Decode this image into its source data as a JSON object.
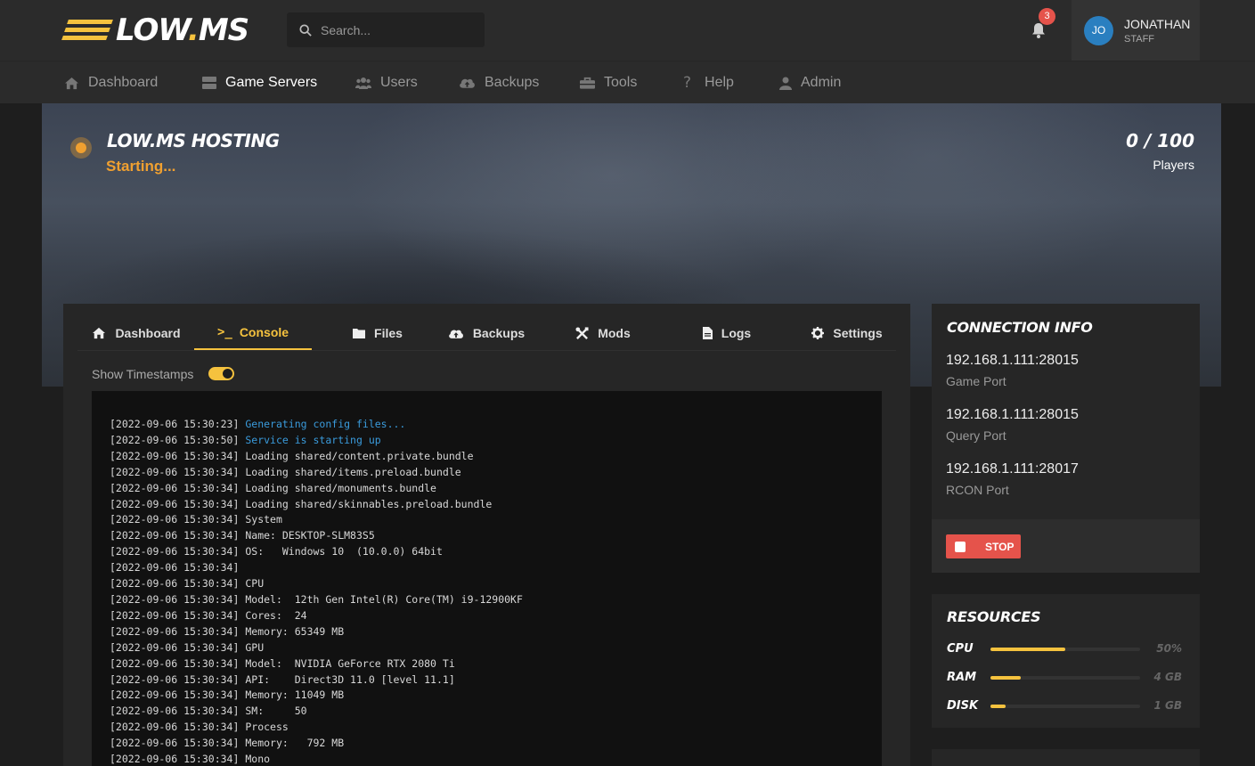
{
  "header": {
    "logo_text": "LOW",
    "logo_dot": ".",
    "logo_suffix": "MS",
    "search_placeholder": "Search...",
    "notification_count": "3",
    "user": {
      "initials": "JO",
      "name": "JONATHAN",
      "role": "STAFF"
    }
  },
  "nav": [
    {
      "label": "Dashboard",
      "icon": "home-icon"
    },
    {
      "label": "Game Servers",
      "icon": "server-icon",
      "active": true
    },
    {
      "label": "Users",
      "icon": "users-icon"
    },
    {
      "label": "Backups",
      "icon": "cloud-upload-icon"
    },
    {
      "label": "Tools",
      "icon": "toolbox-icon"
    },
    {
      "label": "Help",
      "icon": "question-icon"
    },
    {
      "label": "Admin",
      "icon": "user-icon"
    }
  ],
  "server": {
    "name": "LOW.MS HOSTING",
    "status": "Starting...",
    "status_color": "#f0a030",
    "players": "0 / 100",
    "players_label": "Players"
  },
  "tabs": [
    {
      "label": "Dashboard",
      "icon": "home-icon"
    },
    {
      "label": "Console",
      "icon": "terminal-icon",
      "active": true
    },
    {
      "label": "Files",
      "icon": "folder-icon"
    },
    {
      "label": "Backups",
      "icon": "cloud-upload-icon"
    },
    {
      "label": "Mods",
      "icon": "tools-icon"
    },
    {
      "label": "Logs",
      "icon": "file-icon"
    },
    {
      "label": "Settings",
      "icon": "gear-icon"
    }
  ],
  "console": {
    "show_timestamps_label": "Show Timestamps",
    "show_timestamps": true,
    "lines": [
      {
        "ts": "[2022-09-06 15:30:23]",
        "msg": "Generating config files...",
        "highlight": true
      },
      {
        "ts": "[2022-09-06 15:30:50]",
        "msg": "Service is starting up",
        "highlight": true
      },
      {
        "ts": "[2022-09-06 15:30:34]",
        "msg": "Loading shared/content.private.bundle"
      },
      {
        "ts": "[2022-09-06 15:30:34]",
        "msg": "Loading shared/items.preload.bundle"
      },
      {
        "ts": "[2022-09-06 15:30:34]",
        "msg": "Loading shared/monuments.bundle"
      },
      {
        "ts": "[2022-09-06 15:30:34]",
        "msg": "Loading shared/skinnables.preload.bundle"
      },
      {
        "ts": "[2022-09-06 15:30:34]",
        "msg": "System"
      },
      {
        "ts": "[2022-09-06 15:30:34]",
        "msg": "Name: DESKTOP-SLM83S5"
      },
      {
        "ts": "[2022-09-06 15:30:34]",
        "msg": "OS:   Windows 10  (10.0.0) 64bit"
      },
      {
        "ts": "[2022-09-06 15:30:34]",
        "msg": ""
      },
      {
        "ts": "[2022-09-06 15:30:34]",
        "msg": "CPU"
      },
      {
        "ts": "[2022-09-06 15:30:34]",
        "msg": "Model:  12th Gen Intel(R) Core(TM) i9-12900KF"
      },
      {
        "ts": "[2022-09-06 15:30:34]",
        "msg": "Cores:  24"
      },
      {
        "ts": "[2022-09-06 15:30:34]",
        "msg": "Memory: 65349 MB"
      },
      {
        "ts": "[2022-09-06 15:30:34]",
        "msg": "GPU"
      },
      {
        "ts": "[2022-09-06 15:30:34]",
        "msg": "Model:  NVIDIA GeForce RTX 2080 Ti"
      },
      {
        "ts": "[2022-09-06 15:30:34]",
        "msg": "API:    Direct3D 11.0 [level 11.1]"
      },
      {
        "ts": "[2022-09-06 15:30:34]",
        "msg": "Memory: 11049 MB"
      },
      {
        "ts": "[2022-09-06 15:30:34]",
        "msg": "SM:     50"
      },
      {
        "ts": "[2022-09-06 15:30:34]",
        "msg": "Process"
      },
      {
        "ts": "[2022-09-06 15:30:34]",
        "msg": "Memory:   792 MB"
      },
      {
        "ts": "[2022-09-06 15:30:34]",
        "msg": "Mono"
      }
    ]
  },
  "connection": {
    "title": "CONNECTION INFO",
    "entries": [
      {
        "address": "192.168.1.111:28015",
        "label": "Game Port"
      },
      {
        "address": "192.168.1.111:28015",
        "label": "Query Port"
      },
      {
        "address": "192.168.1.111:28017",
        "label": "RCON Port"
      }
    ],
    "stop_label": "STOP"
  },
  "resources": {
    "title": "RESOURCES",
    "items": [
      {
        "name": "CPU",
        "value": "50%",
        "fraction": 0.5
      },
      {
        "name": "RAM",
        "value": "4 GB",
        "fraction": 0.2
      },
      {
        "name": "DISK",
        "value": "1 GB",
        "fraction": 0.1
      }
    ]
  },
  "colors": {
    "accent": "#f5c23e",
    "danger": "#e5534b",
    "info": "#3a9bdc"
  }
}
